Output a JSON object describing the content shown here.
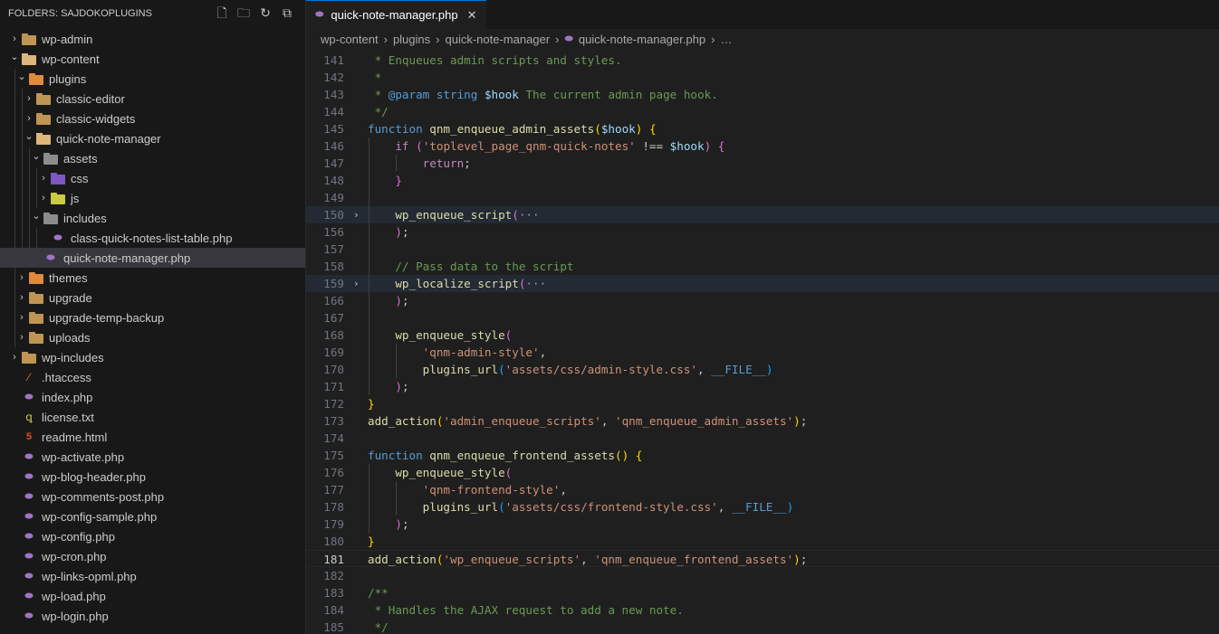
{
  "sidebar": {
    "header": "FOLDERS: SAJDOKOPLUGINS",
    "actions": [
      "new-file-icon",
      "new-folder-icon",
      "refresh-icon",
      "collapse-icon"
    ],
    "items": [
      {
        "label": "wp-admin",
        "depth": 0,
        "chev": "›",
        "icon": "folder"
      },
      {
        "label": "wp-content",
        "depth": 0,
        "chev": "⌄",
        "icon": "folder-open"
      },
      {
        "label": "plugins",
        "depth": 1,
        "chev": "⌄",
        "icon": "folder-special"
      },
      {
        "label": "classic-editor",
        "depth": 2,
        "chev": "›",
        "icon": "folder"
      },
      {
        "label": "classic-widgets",
        "depth": 2,
        "chev": "›",
        "icon": "folder"
      },
      {
        "label": "quick-note-manager",
        "depth": 2,
        "chev": "⌄",
        "icon": "folder-open"
      },
      {
        "label": "assets",
        "depth": 3,
        "chev": "⌄",
        "icon": "folder-gray"
      },
      {
        "label": "css",
        "depth": 4,
        "chev": "›",
        "icon": "folder-purple"
      },
      {
        "label": "js",
        "depth": 4,
        "chev": "›",
        "icon": "folder-yellow"
      },
      {
        "label": "includes",
        "depth": 3,
        "chev": "⌄",
        "icon": "folder-gray"
      },
      {
        "label": "class-quick-notes-list-table.php",
        "depth": 4,
        "chev": "",
        "icon": "php"
      },
      {
        "label": "quick-note-manager.php",
        "depth": 3,
        "chev": "",
        "icon": "php",
        "selected": true
      },
      {
        "label": "themes",
        "depth": 1,
        "chev": "›",
        "icon": "folder-special"
      },
      {
        "label": "upgrade",
        "depth": 1,
        "chev": "›",
        "icon": "folder"
      },
      {
        "label": "upgrade-temp-backup",
        "depth": 1,
        "chev": "›",
        "icon": "folder"
      },
      {
        "label": "uploads",
        "depth": 1,
        "chev": "›",
        "icon": "folder"
      },
      {
        "label": "wp-includes",
        "depth": 0,
        "chev": "›",
        "icon": "folder"
      },
      {
        "label": ".htaccess",
        "depth": 0,
        "chev": "",
        "icon": "htaccess"
      },
      {
        "label": "index.php",
        "depth": 0,
        "chev": "",
        "icon": "php"
      },
      {
        "label": "license.txt",
        "depth": 0,
        "chev": "",
        "icon": "txt"
      },
      {
        "label": "readme.html",
        "depth": 0,
        "chev": "",
        "icon": "html"
      },
      {
        "label": "wp-activate.php",
        "depth": 0,
        "chev": "",
        "icon": "php"
      },
      {
        "label": "wp-blog-header.php",
        "depth": 0,
        "chev": "",
        "icon": "php"
      },
      {
        "label": "wp-comments-post.php",
        "depth": 0,
        "chev": "",
        "icon": "php"
      },
      {
        "label": "wp-config-sample.php",
        "depth": 0,
        "chev": "",
        "icon": "php"
      },
      {
        "label": "wp-config.php",
        "depth": 0,
        "chev": "",
        "icon": "php"
      },
      {
        "label": "wp-cron.php",
        "depth": 0,
        "chev": "",
        "icon": "php"
      },
      {
        "label": "wp-links-opml.php",
        "depth": 0,
        "chev": "",
        "icon": "php"
      },
      {
        "label": "wp-load.php",
        "depth": 0,
        "chev": "",
        "icon": "php"
      },
      {
        "label": "wp-login.php",
        "depth": 0,
        "chev": "",
        "icon": "php"
      }
    ]
  },
  "tab": {
    "label": "quick-note-manager.php",
    "close": "✕"
  },
  "breadcrumb": [
    "wp-content",
    "plugins",
    "quick-note-manager",
    "quick-note-manager.php",
    "…"
  ],
  "code": [
    {
      "n": "141",
      "tokens": [
        [
          " * Enqueues admin scripts and styles.",
          "c"
        ]
      ]
    },
    {
      "n": "142",
      "tokens": [
        [
          " *",
          "c"
        ]
      ]
    },
    {
      "n": "143",
      "tokens": [
        [
          " * ",
          "c"
        ],
        [
          "@param",
          "k"
        ],
        [
          " ",
          "c"
        ],
        [
          "string",
          "k"
        ],
        [
          " ",
          "c"
        ],
        [
          "$hook",
          "v"
        ],
        [
          " The current admin page hook.",
          "c"
        ]
      ]
    },
    {
      "n": "144",
      "tokens": [
        [
          " */",
          "c"
        ]
      ]
    },
    {
      "n": "145",
      "tokens": [
        [
          "function",
          "k"
        ],
        [
          " ",
          "p"
        ],
        [
          "qnm_enqueue_admin_assets",
          "f"
        ],
        [
          "(",
          "b1"
        ],
        [
          "$hook",
          "v"
        ],
        [
          ")",
          "b1"
        ],
        [
          " ",
          "p"
        ],
        [
          "{",
          "b1"
        ]
      ]
    },
    {
      "n": "146",
      "guides": [
        1
      ],
      "tokens": [
        [
          "    ",
          "p"
        ],
        [
          "if",
          "ctl"
        ],
        [
          " ",
          "p"
        ],
        [
          "(",
          "b2"
        ],
        [
          "'toplevel_page_qnm-quick-notes'",
          "s"
        ],
        [
          " !== ",
          "p"
        ],
        [
          "$hook",
          "v"
        ],
        [
          ")",
          "b2"
        ],
        [
          " ",
          "p"
        ],
        [
          "{",
          "b2"
        ]
      ]
    },
    {
      "n": "147",
      "guides": [
        1,
        2
      ],
      "tokens": [
        [
          "        ",
          "p"
        ],
        [
          "return",
          "ctl"
        ],
        [
          ";",
          "p"
        ]
      ]
    },
    {
      "n": "148",
      "guides": [
        1
      ],
      "tokens": [
        [
          "    ",
          "p"
        ],
        [
          "}",
          "b2"
        ]
      ]
    },
    {
      "n": "149",
      "guides": [
        1
      ],
      "tokens": []
    },
    {
      "n": "150",
      "fold": "›",
      "hl": true,
      "guides": [
        1
      ],
      "tokens": [
        [
          "    ",
          "p"
        ],
        [
          "wp_enqueue_script",
          "f"
        ],
        [
          "(",
          "b2"
        ],
        [
          "···",
          "dots"
        ]
      ]
    },
    {
      "n": "156",
      "guides": [
        1
      ],
      "tokens": [
        [
          "    ",
          "p"
        ],
        [
          ")",
          "b2"
        ],
        [
          ";",
          "p"
        ]
      ]
    },
    {
      "n": "157",
      "guides": [
        1
      ],
      "tokens": []
    },
    {
      "n": "158",
      "guides": [
        1
      ],
      "tokens": [
        [
          "    ",
          "p"
        ],
        [
          "// Pass data to the script",
          "c"
        ]
      ]
    },
    {
      "n": "159",
      "fold": "›",
      "hl": true,
      "guides": [
        1
      ],
      "tokens": [
        [
          "    ",
          "p"
        ],
        [
          "wp_localize_script",
          "f"
        ],
        [
          "(",
          "b2"
        ],
        [
          "···",
          "dots"
        ]
      ]
    },
    {
      "n": "166",
      "guides": [
        1
      ],
      "tokens": [
        [
          "    ",
          "p"
        ],
        [
          ")",
          "b2"
        ],
        [
          ";",
          "p"
        ]
      ]
    },
    {
      "n": "167",
      "guides": [
        1
      ],
      "tokens": []
    },
    {
      "n": "168",
      "guides": [
        1
      ],
      "tokens": [
        [
          "    ",
          "p"
        ],
        [
          "wp_enqueue_style",
          "f"
        ],
        [
          "(",
          "b2"
        ]
      ]
    },
    {
      "n": "169",
      "guides": [
        1,
        2
      ],
      "tokens": [
        [
          "        ",
          "p"
        ],
        [
          "'qnm-admin-style'",
          "s"
        ],
        [
          ",",
          "p"
        ]
      ]
    },
    {
      "n": "170",
      "guides": [
        1,
        2
      ],
      "tokens": [
        [
          "        ",
          "p"
        ],
        [
          "plugins_url",
          "f"
        ],
        [
          "(",
          "b3"
        ],
        [
          "'assets/css/admin-style.css'",
          "s"
        ],
        [
          ", ",
          "p"
        ],
        [
          "__FILE__",
          "kc"
        ],
        [
          ")",
          "b3"
        ]
      ]
    },
    {
      "n": "171",
      "guides": [
        1
      ],
      "tokens": [
        [
          "    ",
          "p"
        ],
        [
          ")",
          "b2"
        ],
        [
          ";",
          "p"
        ]
      ]
    },
    {
      "n": "172",
      "tokens": [
        [
          "}",
          "b1"
        ]
      ]
    },
    {
      "n": "173",
      "tokens": [
        [
          "add_action",
          "f"
        ],
        [
          "(",
          "b1"
        ],
        [
          "'admin_enqueue_scripts'",
          "s"
        ],
        [
          ", ",
          "p"
        ],
        [
          "'qnm_enqueue_admin_assets'",
          "s"
        ],
        [
          ")",
          "b1"
        ],
        [
          ";",
          "p"
        ]
      ]
    },
    {
      "n": "174",
      "tokens": []
    },
    {
      "n": "175",
      "tokens": [
        [
          "function",
          "k"
        ],
        [
          " ",
          "p"
        ],
        [
          "qnm_enqueue_frontend_assets",
          "f"
        ],
        [
          "()",
          "b1"
        ],
        [
          " ",
          "p"
        ],
        [
          "{",
          "b1"
        ]
      ]
    },
    {
      "n": "176",
      "guides": [
        1
      ],
      "tokens": [
        [
          "    ",
          "p"
        ],
        [
          "wp_enqueue_style",
          "f"
        ],
        [
          "(",
          "b2"
        ]
      ]
    },
    {
      "n": "177",
      "guides": [
        1,
        2
      ],
      "tokens": [
        [
          "        ",
          "p"
        ],
        [
          "'qnm-frontend-style'",
          "s"
        ],
        [
          ",",
          "p"
        ]
      ]
    },
    {
      "n": "178",
      "guides": [
        1,
        2
      ],
      "tokens": [
        [
          "        ",
          "p"
        ],
        [
          "plugins_url",
          "f"
        ],
        [
          "(",
          "b3"
        ],
        [
          "'assets/css/frontend-style.css'",
          "s"
        ],
        [
          ", ",
          "p"
        ],
        [
          "__FILE__",
          "kc"
        ],
        [
          ")",
          "b3"
        ]
      ]
    },
    {
      "n": "179",
      "guides": [
        1
      ],
      "tokens": [
        [
          "    ",
          "p"
        ],
        [
          ")",
          "b2"
        ],
        [
          ";",
          "p"
        ]
      ]
    },
    {
      "n": "180",
      "tokens": [
        [
          "}",
          "b1"
        ]
      ]
    },
    {
      "n": "181",
      "current": true,
      "tokens": [
        [
          "add_action",
          "f"
        ],
        [
          "(",
          "b1"
        ],
        [
          "'wp_enqueue_scripts'",
          "s"
        ],
        [
          ", ",
          "p"
        ],
        [
          "'qnm_enqueue_frontend_assets'",
          "s"
        ],
        [
          ")",
          "b1"
        ],
        [
          ";",
          "p"
        ]
      ]
    },
    {
      "n": "182",
      "tokens": []
    },
    {
      "n": "183",
      "tokens": [
        [
          "/**",
          "c"
        ]
      ]
    },
    {
      "n": "184",
      "tokens": [
        [
          " * Handles the AJAX request to add a new note.",
          "c"
        ]
      ]
    },
    {
      "n": "185",
      "tokens": [
        [
          " */",
          "c"
        ]
      ]
    }
  ]
}
